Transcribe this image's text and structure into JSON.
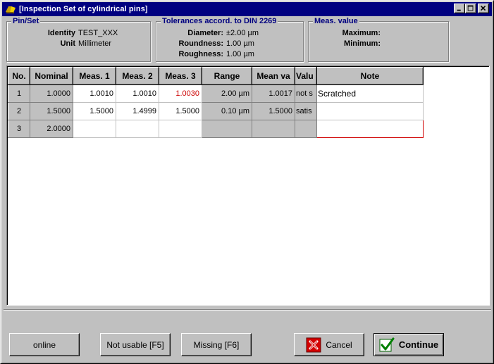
{
  "window": {
    "title": "[Inspection Set of cylindrical pins]"
  },
  "pin_set": {
    "title": "Pin/Set",
    "identity_label": "Identity",
    "identity_value": "TEST_XXX",
    "unit_label": "Unit",
    "unit_value": "Millimeter"
  },
  "tolerances": {
    "title": "Tolerances accord. to DIN 2269",
    "diameter_label": "Diameter:",
    "diameter_value": "±2.00 µm",
    "roundness_label": "Roundness:",
    "roundness_value": "1.00 µm",
    "roughness_label": "Roughness:",
    "roughness_value": "1.00 µm"
  },
  "meas_value": {
    "title": "Meas. value",
    "maximum_label": "Maximum:",
    "minimum_label": "Minimum:"
  },
  "grid": {
    "headers": [
      "No.",
      "Nominal",
      "Meas. 1",
      "Meas. 2",
      "Meas. 3",
      "Range",
      "Mean va",
      "Valu",
      "Note"
    ],
    "rows": [
      {
        "no": "1",
        "nominal": "1.0000",
        "meas1": "1.0010",
        "meas2": "1.0010",
        "meas3": "1.0030",
        "range": "2.00 µm",
        "mean": "1.0017",
        "value": "not s",
        "note": "Scratched"
      },
      {
        "no": "2",
        "nominal": "1.5000",
        "meas1": "1.5000",
        "meas2": "1.4999",
        "meas3": "1.5000",
        "range": "0.10 µm",
        "mean": "1.5000",
        "value": "satis",
        "note": ""
      },
      {
        "no": "3",
        "nominal": "2.0000",
        "meas1": "",
        "meas2": "",
        "meas3": "",
        "range": "",
        "mean": "",
        "value": "",
        "note": ""
      }
    ]
  },
  "buttons": {
    "online": "online",
    "not_usable": "Not usable [F5]",
    "missing": "Missing [F6]",
    "cancel": "Cancel",
    "continue": "Continue"
  },
  "colors": {
    "title_bar": "#000080",
    "group_title": "#000080",
    "out_of_tolerance": "#cc0000",
    "cancel_icon": "#d40000",
    "continue_icon": "#008000"
  },
  "icons": {
    "app": "pin-app-icon",
    "minimize": "minimize-icon",
    "maximize": "maximize-icon",
    "close": "close-icon",
    "cancel": "cancel-x-icon",
    "continue": "check-icon"
  }
}
